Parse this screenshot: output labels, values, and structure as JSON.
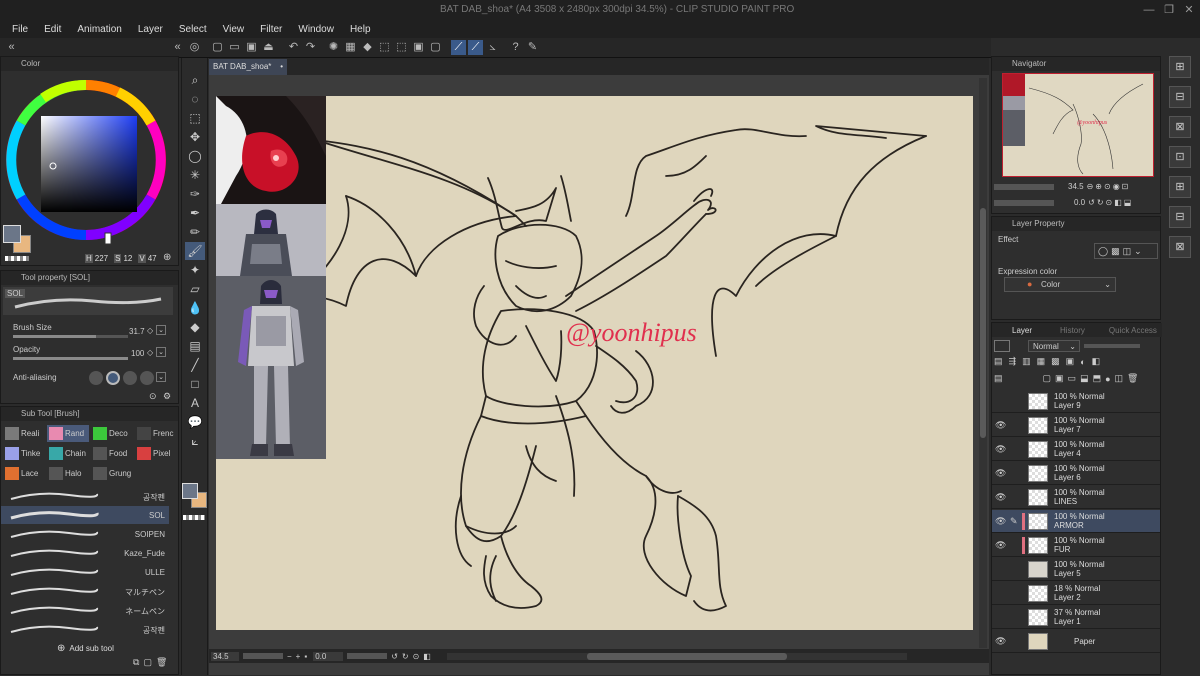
{
  "window": {
    "title": "BAT DAB_shoa* (A4 3508 x 2480px 300dpi 34.5%) - CLIP STUDIO PAINT PRO",
    "controls": [
      "—",
      "❐",
      "✕"
    ]
  },
  "menu": [
    "File",
    "Edit",
    "Animation",
    "Layer",
    "Select",
    "View",
    "Filter",
    "Window",
    "Help"
  ],
  "document": {
    "tab": "BAT DAB_shoa*",
    "zoom": "34.5",
    "angle": "0.0"
  },
  "canvas": {
    "signature": "@yoonhipus",
    "paper_color": "#dfd6bd",
    "line_color": "#2a2520",
    "sig_color": "#e0304e"
  },
  "color_panel": {
    "title": "Color",
    "readout": {
      "h_label": "H",
      "h": "227",
      "s_label": "S",
      "s": "12",
      "v_label": "V",
      "v": "47"
    },
    "main_color": "#6b7688",
    "sub_color": "#e8b780"
  },
  "tool_property": {
    "title": "Tool property [SOL]",
    "brush_name": "SOL",
    "brush_size": {
      "label": "Brush Size",
      "value": "31.7",
      "fill": 0.72
    },
    "opacity": {
      "label": "Opacity",
      "value": "100",
      "fill": 1.0
    },
    "anti_aliasing": {
      "label": "Anti-aliasing"
    }
  },
  "sub_tool": {
    "title": "Sub Tool [Brush]",
    "groups": [
      {
        "label": "Reali",
        "color": "#7a7a7a"
      },
      {
        "label": "Rand",
        "color": "#e88ab0",
        "selected": true
      },
      {
        "label": "Deco",
        "color": "#3cc83c"
      },
      {
        "label": "Frenc",
        "color": "#444"
      },
      {
        "label": "Tinke",
        "color": "#9aa0e8"
      },
      {
        "label": "Chain",
        "color": "#38a8a8"
      },
      {
        "label": "Food",
        "color": "#555"
      },
      {
        "label": "Pixel",
        "color": "#d84040"
      },
      {
        "label": "Lace",
        "color": "#e07030"
      },
      {
        "label": "Halo",
        "color": "#555"
      },
      {
        "label": "Grung",
        "color": "#555"
      }
    ],
    "brushes": [
      "공작펜",
      "SOL",
      "SOIPEN",
      "Kaze_Fude",
      "ULLE",
      "マルチペン",
      "ネームペン",
      "공작펜"
    ],
    "selected_brush": "SOL",
    "add_label": "Add sub tool"
  },
  "navigator": {
    "title": "Navigator",
    "zoom": "34.5",
    "angle": "0.0"
  },
  "layer_property": {
    "title": "Layer Property",
    "effect_label": "Effect",
    "expression_label": "Expression color",
    "expression_value": "Color"
  },
  "layer_panel": {
    "tabs": [
      "Layer",
      "History",
      "Quick Access"
    ],
    "blend_mode": "Normal",
    "layers": [
      {
        "opacity": "100 % Normal",
        "name": "Layer 9",
        "visible": false
      },
      {
        "opacity": "100 % Normal",
        "name": "Layer 7",
        "visible": true
      },
      {
        "opacity": "100 % Normal",
        "name": "Layer 4",
        "visible": true
      },
      {
        "opacity": "100 % Normal",
        "name": "Layer 6",
        "visible": true
      },
      {
        "opacity": "100 % Normal",
        "name": "LINES",
        "visible": true
      },
      {
        "opacity": "100 % Normal",
        "name": "ARMOR",
        "visible": true,
        "selected": true
      },
      {
        "opacity": "100 % Normal",
        "name": "FUR",
        "visible": true
      },
      {
        "opacity": "100 % Normal",
        "name": "Layer 5",
        "visible": false
      },
      {
        "opacity": "18 % Normal",
        "name": "Layer 2",
        "visible": false
      },
      {
        "opacity": "37 % Normal",
        "name": "Layer 1",
        "visible": false
      },
      {
        "opacity": "",
        "name": "Paper",
        "visible": true
      }
    ]
  }
}
